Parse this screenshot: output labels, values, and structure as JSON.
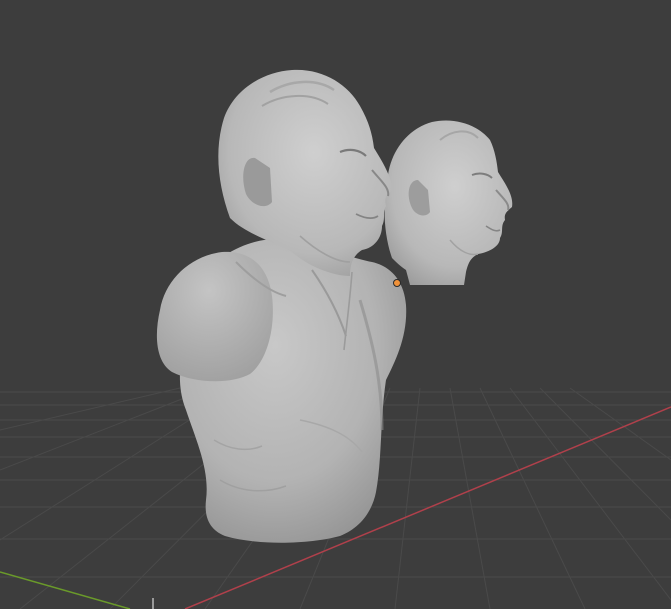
{
  "viewport": {
    "background": "#3d3d3d",
    "grid_color": "#4a4a4a",
    "x_axis_color": "#b0404b",
    "y_axis_color": "#6a9a2a",
    "origin_color": "#f0923a"
  },
  "objects": [
    {
      "name": "bust-sculpt",
      "kind": "mesh",
      "material_color": "#b8b8b8"
    },
    {
      "name": "head-sculpt",
      "kind": "mesh",
      "material_color": "#bdbdbd"
    }
  ]
}
